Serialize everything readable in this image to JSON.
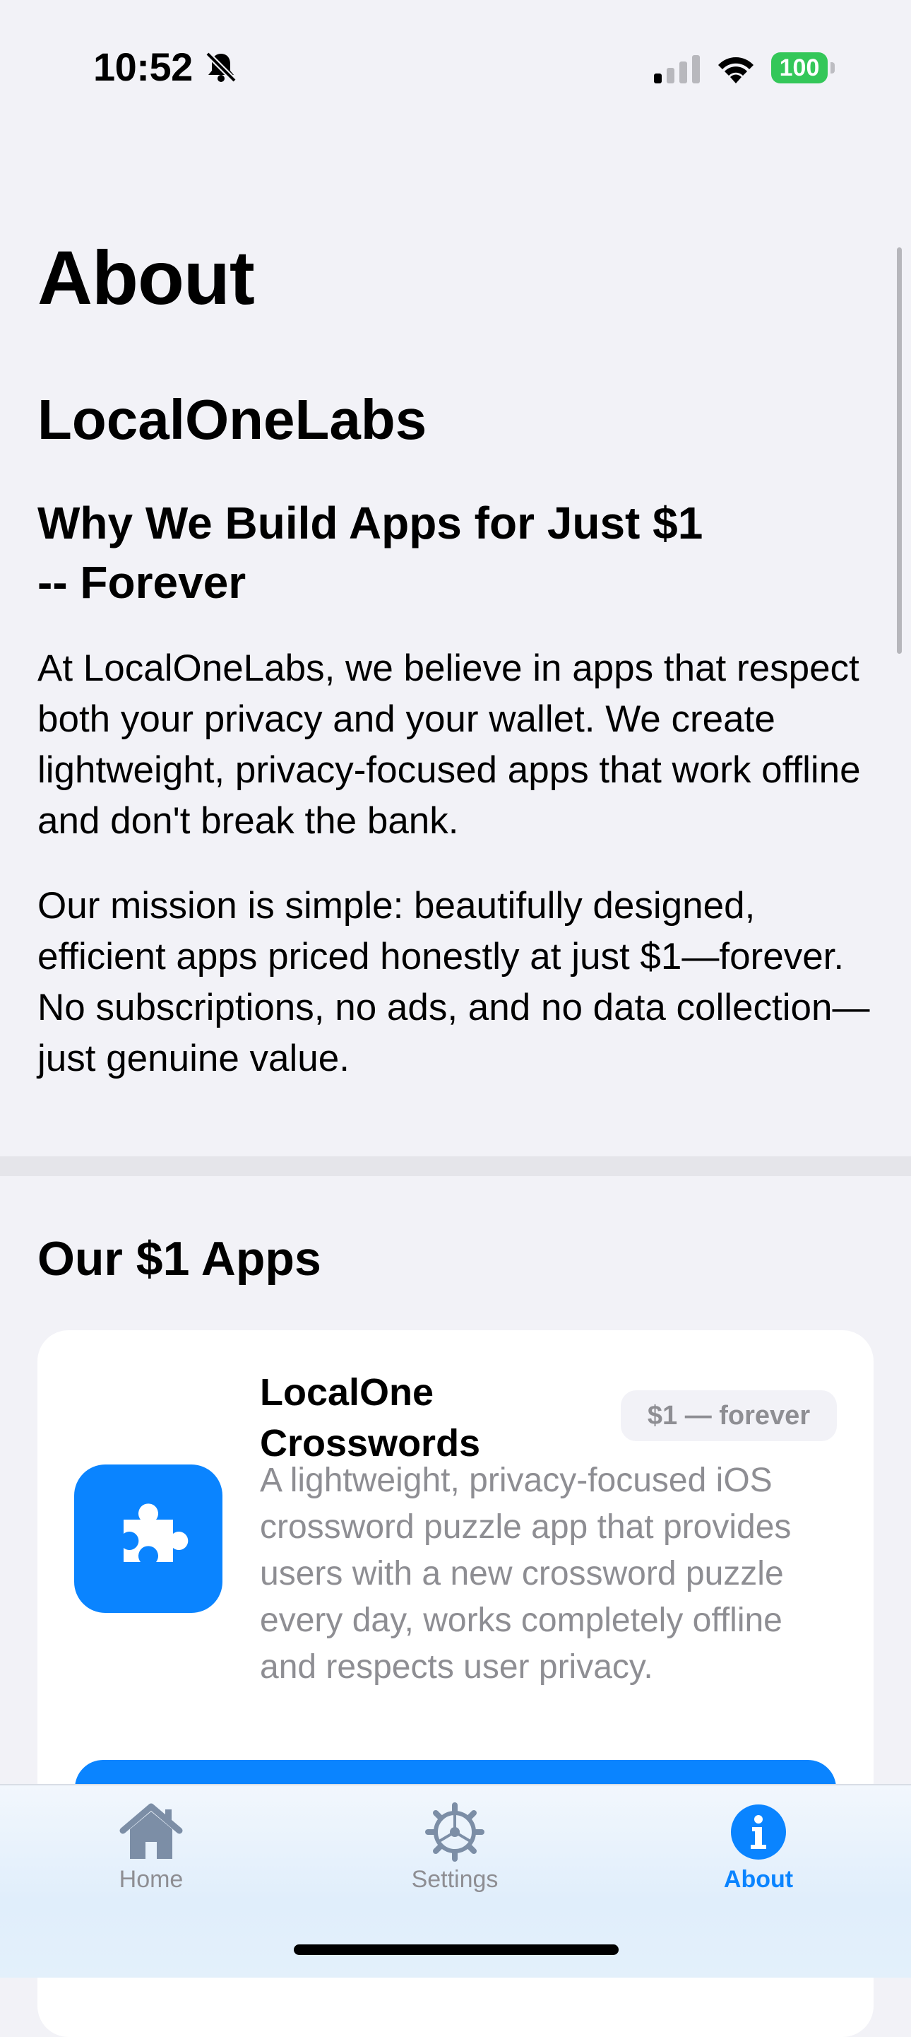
{
  "status_bar": {
    "time": "10:52",
    "battery": "100",
    "icons": [
      "bell-slash-icon",
      "cellular-signal-icon",
      "wifi-icon",
      "battery-icon"
    ]
  },
  "page": {
    "title": "About"
  },
  "about": {
    "company": "LocalOneLabs",
    "heading_line1": "Why We Build Apps for Just $1",
    "heading_line2": "-- Forever",
    "paragraph1": "At LocalOneLabs, we believe in apps that respect both your privacy and your wallet. We create lightweight, privacy-focused apps that work offline and don't break the bank.",
    "paragraph2": "Our mission is simple: beautifully designed, efficient apps priced honestly at just $1—forever. No subscriptions, no ads, and no data collection—just genuine value."
  },
  "apps_section": {
    "title": "Our $1 Apps",
    "apps": [
      {
        "name_line1": "LocalOne",
        "name_line2": "Crosswords",
        "price": "$1 — forever",
        "description": "A lightweight, privacy-focused iOS crossword puzzle app that provides users with a new crossword puzzle every day, works completely offline and respects user privacy.",
        "icon": "puzzle-piece-icon",
        "icon_color": "#0A84FF"
      }
    ]
  },
  "tab_bar": {
    "tabs": [
      {
        "label": "Home",
        "icon": "house-icon"
      },
      {
        "label": "Settings",
        "icon": "gear-icon"
      },
      {
        "label": "About",
        "icon": "info-icon",
        "selected": true
      }
    ],
    "accent_color": "#0A84FF",
    "inactive_color": "#8E8E93"
  }
}
